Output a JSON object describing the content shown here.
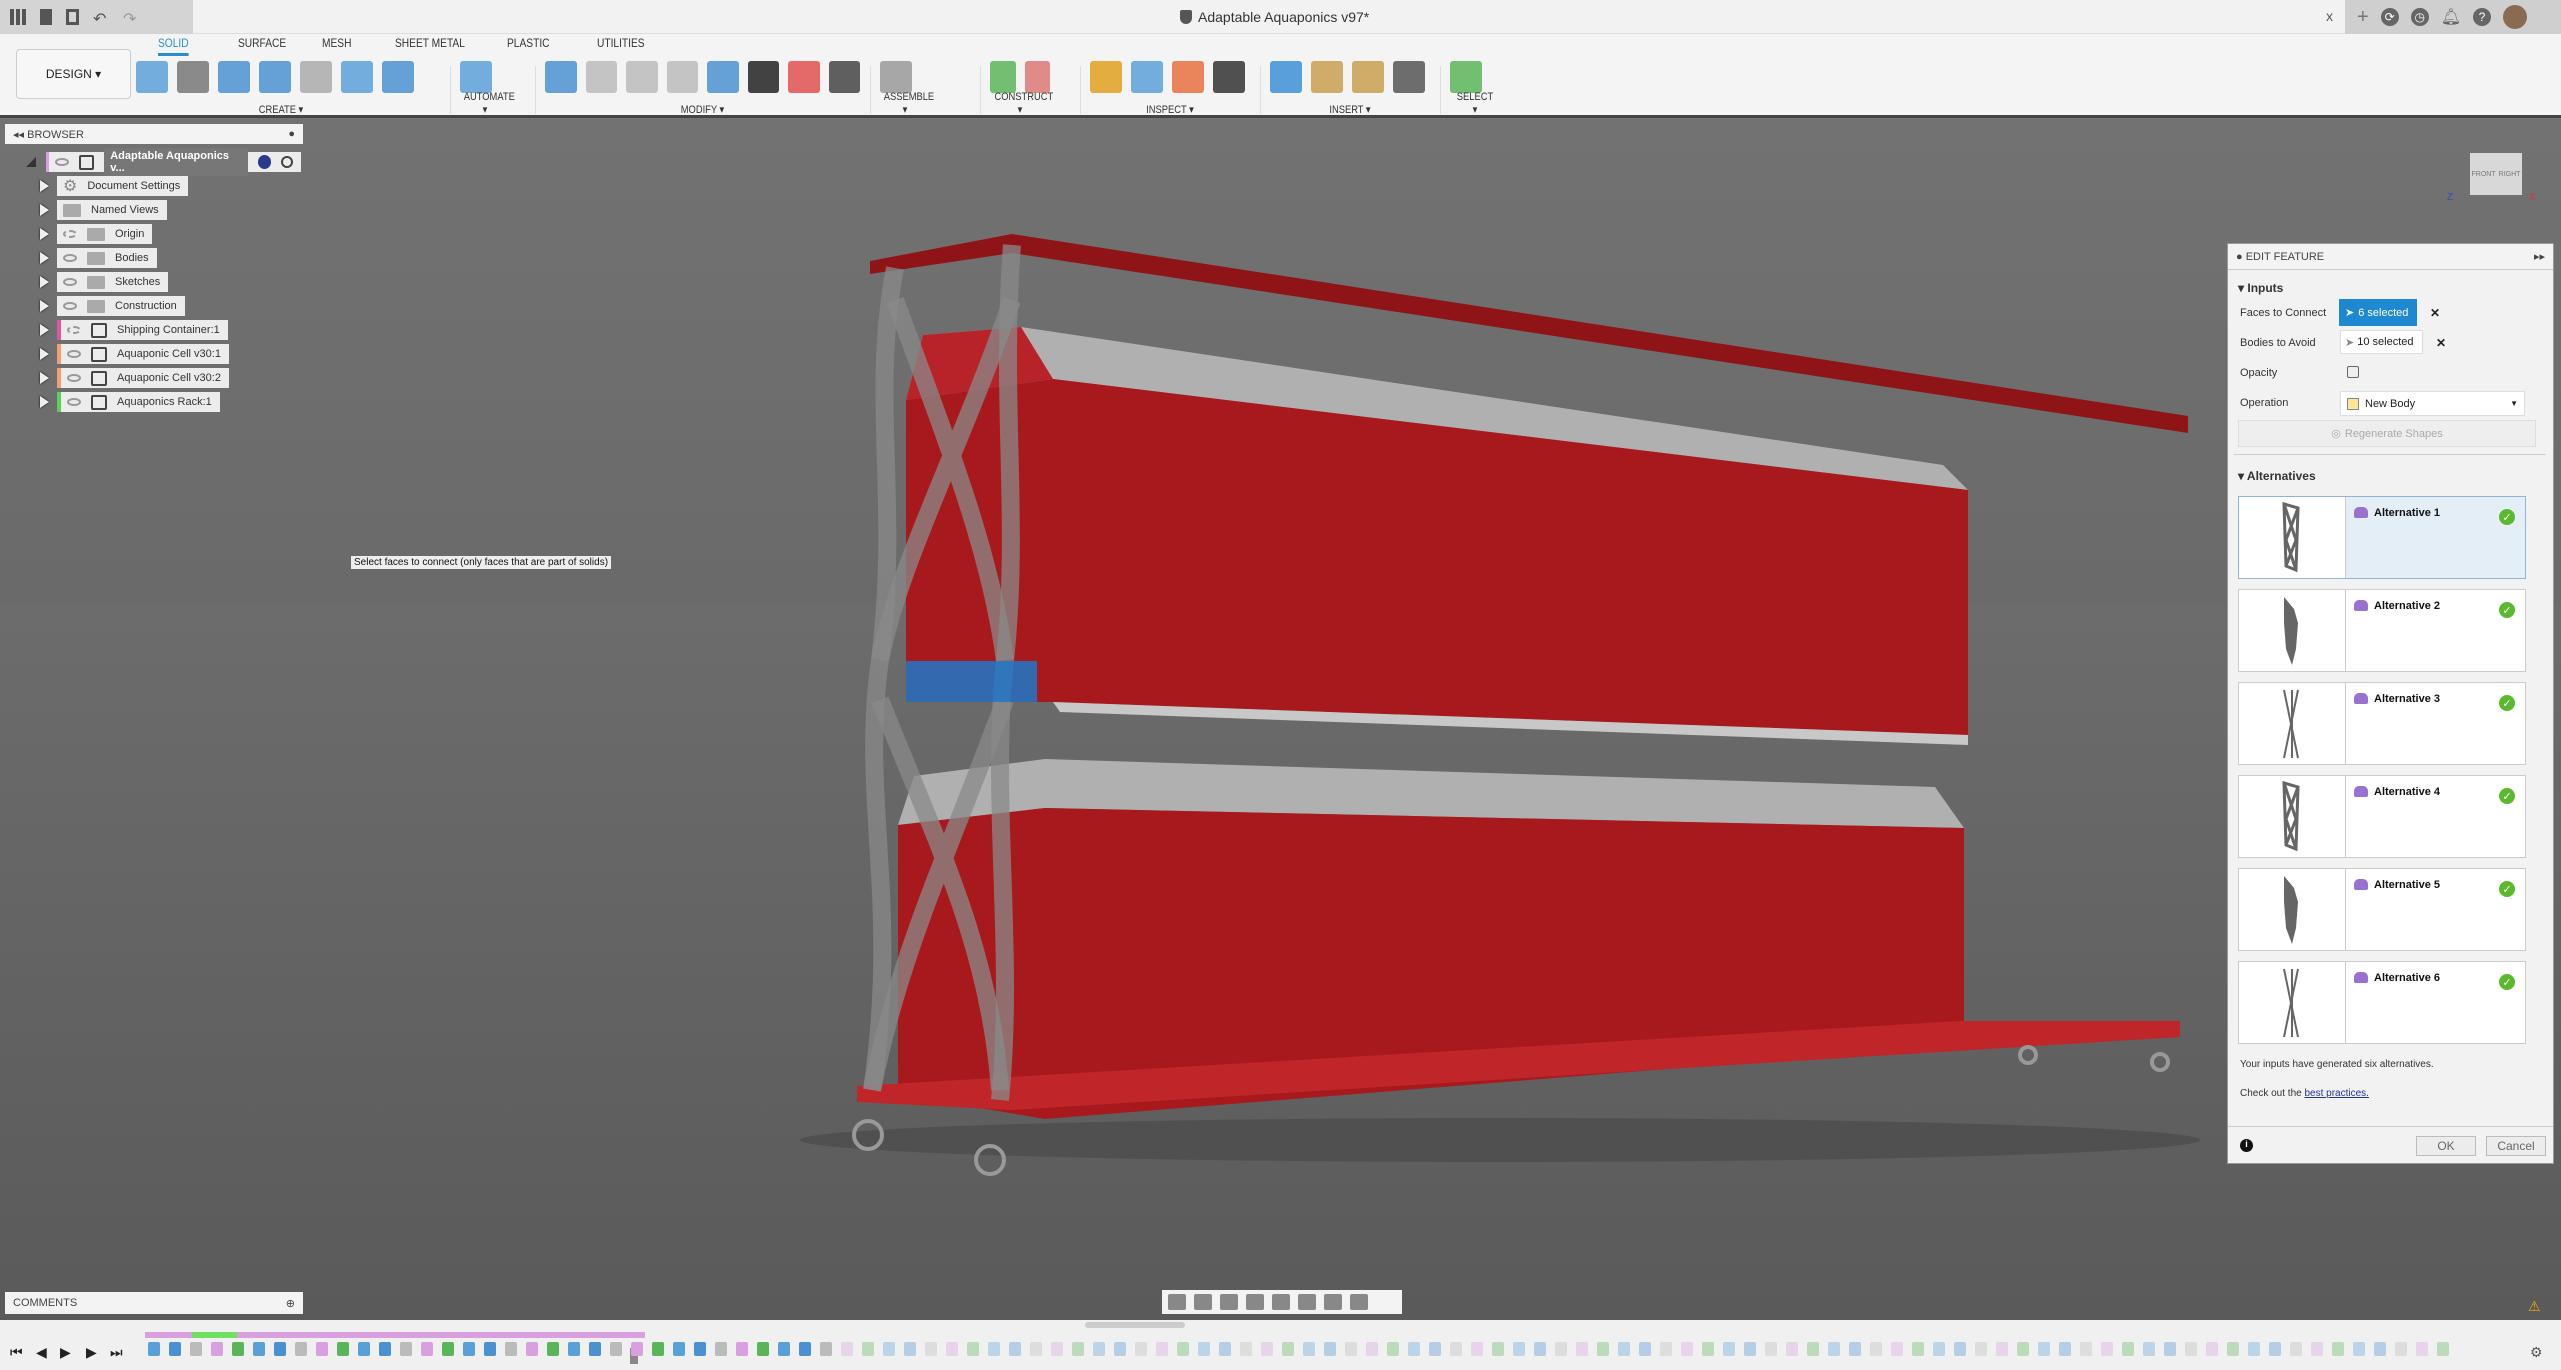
{
  "window": {
    "title": "Adaptable Aquaponics v97*",
    "close": "x",
    "right_icons": [
      "add-tab",
      "extensions",
      "job-status",
      "notifications",
      "help",
      "user-avatar"
    ]
  },
  "toolbar": {
    "workspace": "DESIGN ▾",
    "tabs": [
      {
        "label": "SOLID",
        "active": true
      },
      {
        "label": "SURFACE"
      },
      {
        "label": "MESH"
      },
      {
        "label": "SHEET METAL"
      },
      {
        "label": "PLASTIC"
      },
      {
        "label": "UTILITIES"
      }
    ],
    "groups": [
      {
        "label": "CREATE ▾",
        "icons": [
          "new-component",
          "create-sketch",
          "extrude",
          "revolve",
          "hole",
          "pattern",
          "mirror"
        ],
        "colors": [
          "#5aa0d8",
          "#777",
          "#4b90d0",
          "#4b90d0",
          "#aaa",
          "#5aa0d8",
          "#4b90d0"
        ]
      },
      {
        "label": "AUTOMATE ▾",
        "icons": [
          "automated-modeling"
        ],
        "colors": [
          "#5aa0d8"
        ]
      },
      {
        "label": "MODIFY ▾",
        "icons": [
          "press-pull",
          "fillet",
          "chamfer",
          "shell",
          "draft",
          "move",
          "appearance",
          "parameters"
        ],
        "colors": [
          "#4b90d0",
          "#bbb",
          "#bbb",
          "#bbb",
          "#4b90d0",
          "#222",
          "#e05050",
          "#444"
        ]
      },
      {
        "label": "ASSEMBLE ▾",
        "icons": [
          "joint"
        ],
        "colors": [
          "#999"
        ]
      },
      {
        "label": "CONSTRUCT ▾",
        "icons": [
          "offset-plane",
          "plane-at-angle"
        ],
        "colors": [
          "#5ab55a",
          "#d77"
        ]
      },
      {
        "label": "INSPECT ▾",
        "icons": [
          "measure",
          "section-analysis",
          "curvature-analysis",
          "zebra-analysis"
        ],
        "colors": [
          "#e0a020",
          "#5aa0d8",
          "#e87040",
          "#333"
        ]
      },
      {
        "label": "INSERT ▾",
        "icons": [
          "insert-image",
          "insert-svg",
          "insert-mesh",
          "insert-derive"
        ],
        "colors": [
          "#3d8fd6",
          "#c8a050",
          "#c8a050",
          "#555"
        ]
      },
      {
        "label": "SELECT ▾",
        "icons": [
          "window-select"
        ],
        "colors": [
          "#5ab55a"
        ]
      }
    ]
  },
  "browser": {
    "title": "BROWSER",
    "root": "Adaptable Aquaponics v...",
    "items": [
      {
        "label": "Document Settings",
        "icon": "gear-icon"
      },
      {
        "label": "Named Views",
        "icon": "folder-icon"
      },
      {
        "label": "Origin",
        "icon": "folder-icon",
        "hidden": true,
        "eye": true
      },
      {
        "label": "Bodies",
        "icon": "folder-icon",
        "eye": true
      },
      {
        "label": "Sketches",
        "icon": "folder-icon",
        "eye": true
      },
      {
        "label": "Construction",
        "icon": "folder-icon",
        "eye": true
      },
      {
        "label": "Shipping Container:1",
        "icon": "component-icon",
        "hidden": true,
        "eye": true,
        "color": "#d957a0"
      },
      {
        "label": "Aquaponic Cell v30:1",
        "icon": "component-icon",
        "eye": true,
        "color": "#f0a070"
      },
      {
        "label": "Aquaponic Cell v30:2",
        "icon": "component-icon",
        "eye": true,
        "color": "#f0a070"
      },
      {
        "label": "Aquaponics Rack:1",
        "icon": "component-icon",
        "eye": true,
        "color": "#5ad05a"
      }
    ]
  },
  "tooltip": "Select faces to connect (only faces that are part of solids)",
  "viewcube": {
    "front": "FRONT",
    "right": "RIGHT",
    "z": "Z",
    "x": "X"
  },
  "edit_feature": {
    "title": "EDIT FEATURE",
    "inputs_label": "Inputs",
    "faces_label": "Faces to Connect",
    "faces_value": "6 selected",
    "bodies_label": "Bodies to Avoid",
    "bodies_value": "10 selected",
    "opacity_label": "Opacity",
    "opacity_checked": false,
    "operation_label": "Operation",
    "operation_value": "New Body",
    "regenerate": "Regenerate Shapes",
    "alternatives_label": "Alternatives",
    "alternatives": [
      {
        "name": "Alternative 1",
        "thumbnail": "lattice",
        "selected": true
      },
      {
        "name": "Alternative 2",
        "thumbnail": "solid"
      },
      {
        "name": "Alternative 3",
        "thumbnail": "cross"
      },
      {
        "name": "Alternative 4",
        "thumbnail": "lattice"
      },
      {
        "name": "Alternative 5",
        "thumbnail": "solid"
      },
      {
        "name": "Alternative 6",
        "thumbnail": "cross"
      }
    ],
    "message": "Your inputs have generated six alternatives.",
    "practices_prefix": "Check out the ",
    "practices_link": "best practices.",
    "ok": "OK",
    "cancel": "Cancel"
  },
  "comments": {
    "title": "COMMENTS"
  },
  "colors": {
    "accent": "#2a8fc9",
    "body_red": "#a8191e",
    "selection_blue": "#1e88d0"
  }
}
